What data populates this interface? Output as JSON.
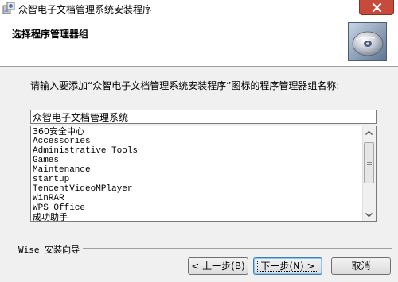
{
  "window": {
    "title": "众智电子文档管理系统安装程序",
    "close_icon": "close-icon"
  },
  "header": {
    "title": "选择程序管理器组",
    "graphic_icon": "cd-disc-icon"
  },
  "main": {
    "instruction": "请输入要添加“众智电子文档管理系统安装程序”图标的程序管理器组名称:",
    "group_name_value": "众智电子文档管理系统",
    "groups": [
      "360安全中心",
      "Accessories",
      "Administrative Tools",
      "Games",
      "Maintenance",
      "startup",
      "TencentVideoMPlayer",
      "WinRAR",
      "WPS Office",
      "成功助手"
    ]
  },
  "footer": {
    "wizard_label": "Wise 安装向导",
    "back_label": "< 上一步(B)",
    "next_label": "下一步(N) >",
    "cancel_label": "取消"
  }
}
